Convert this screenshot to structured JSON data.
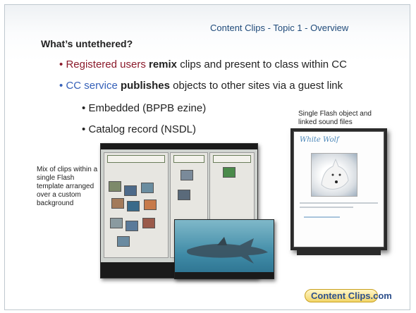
{
  "header": {
    "title": "Content Clips - Topic 1 - Overview"
  },
  "slide": {
    "heading": "What’s untethered?",
    "bullets": [
      {
        "marker": "•",
        "highlight": "Registered users",
        "bold": "remix",
        "rest": "clips and present to class within CC"
      },
      {
        "marker": "•",
        "highlight": "CC service",
        "bold": "publishes",
        "rest": "objects to other sites via a guest link"
      },
      {
        "marker": "•",
        "text": "Embedded (BPPB ezine)"
      },
      {
        "marker": "•",
        "text": "Catalog record (NSDL)"
      }
    ],
    "caption_right": "Single Flash object and linked sound files",
    "caption_left": "Mix of clips within a single Flash template arranged over a custom background",
    "wolf_card_title": "White Wolf",
    "logo_text": "Content Clips.com"
  },
  "colors": {
    "header_text": "#1f4a7a",
    "highlight_red": "#8b1a2b",
    "highlight_blue": "#3560b8"
  }
}
